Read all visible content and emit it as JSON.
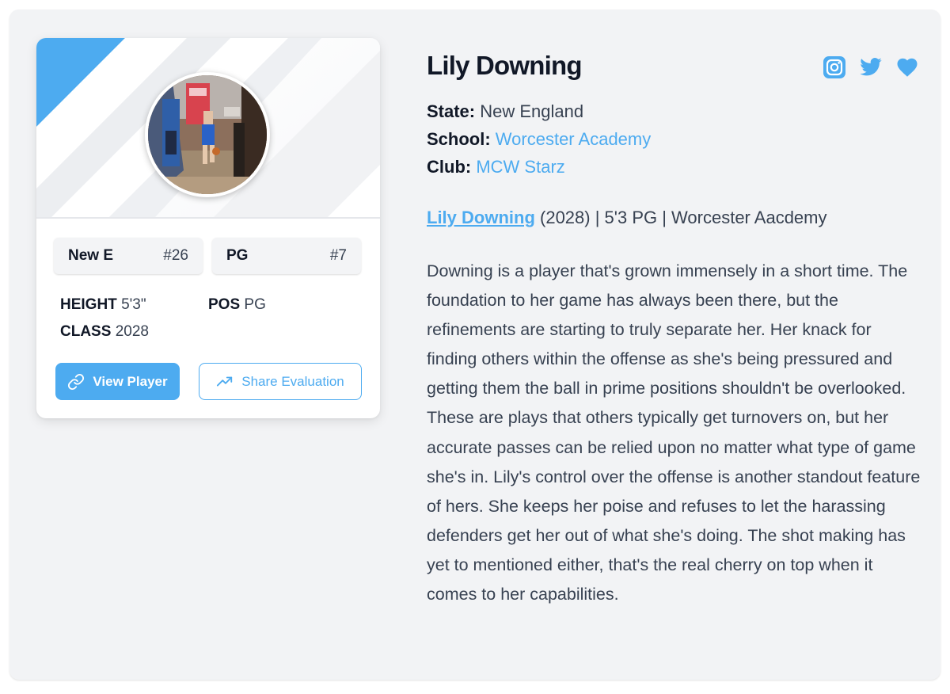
{
  "player": {
    "name": "Lily Downing"
  },
  "card": {
    "rank_region_label": "New E",
    "rank_region_value": "#26",
    "rank_position_label": "PG",
    "rank_position_value": "#7",
    "height_label": "HEIGHT",
    "height_value": "5'3\"",
    "pos_label": "POS",
    "pos_value": "PG",
    "class_label": "CLASS",
    "class_value": "2028",
    "view_button": "View Player",
    "share_button": "Share Evaluation"
  },
  "details": {
    "state_label": "State:",
    "state_value": "New England",
    "school_label": "School:",
    "school_value": "Worcester Academy",
    "club_label": "Club:",
    "club_value": "MCW Starz"
  },
  "summary": {
    "name_link": "Lily Downing",
    "rest": " (2028) | 5'3 PG | Worcester Aacdemy"
  },
  "evaluation": "Downing is a player that's grown immensely in a short time. The foundation to her game has always been there, but the refinements are starting to truly separate her. Her knack for finding others within the offense as she's being pressured and getting them the ball in prime positions shouldn't be overlooked. These are plays that others typically get turnovers on, but her accurate passes can be relied upon no matter what type of game she's in. Lily's control over the offense is another standout feature of hers. She keeps her poise and refuses to let the harassing defenders get her out of what she's doing. The shot making has yet to mentioned either, that's the real cherry on top when it comes to her capabilities.",
  "social_icons": [
    "instagram-icon",
    "twitter-icon",
    "heart-icon"
  ],
  "colors": {
    "accent": "#4dabf0",
    "panel_bg": "#f2f3f5",
    "text": "#374151"
  }
}
